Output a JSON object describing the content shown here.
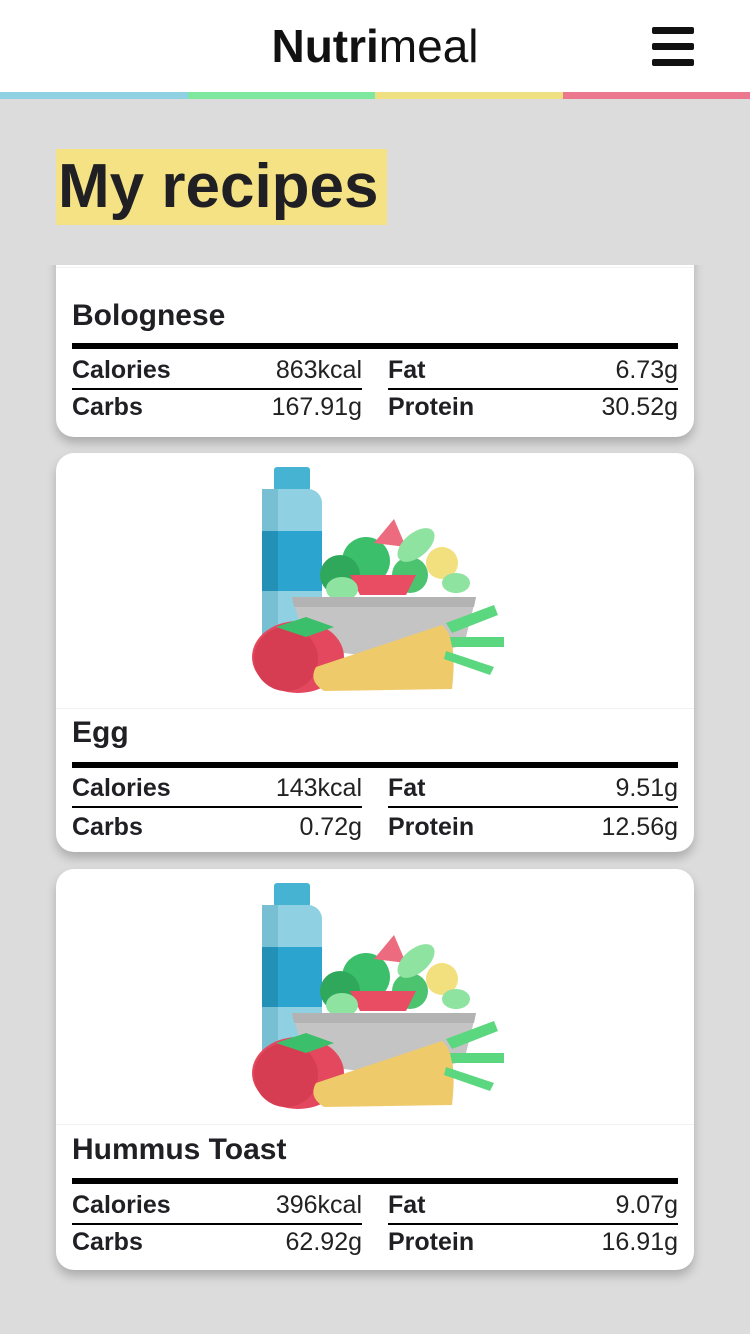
{
  "app": {
    "logo_bold": "Nutri",
    "logo_light": "meal",
    "stripe_colors": [
      "#8fd0e2",
      "#7ee89e",
      "#efe082",
      "#ec7890"
    ]
  },
  "page": {
    "title": "My recipes"
  },
  "recipes": [
    {
      "name": "Bolognese",
      "calories_label": "Calories",
      "calories": "863kcal",
      "fat_label": "Fat",
      "fat": "6.73g",
      "carbs_label": "Carbs",
      "carbs": "167.91g",
      "protein_label": "Protein",
      "protein": "30.52g"
    },
    {
      "name": "Egg",
      "calories_label": "Calories",
      "calories": "143kcal",
      "fat_label": "Fat",
      "fat": "9.51g",
      "carbs_label": "Carbs",
      "carbs": "0.72g",
      "protein_label": "Protein",
      "protein": "12.56g"
    },
    {
      "name": "Hummus Toast",
      "calories_label": "Calories",
      "calories": "396kcal",
      "fat_label": "Fat",
      "fat": "9.07g",
      "carbs_label": "Carbs",
      "carbs": "62.92g",
      "protein_label": "Protein",
      "protein": "16.91g"
    }
  ],
  "icons": {
    "menu": "hamburger-menu-icon",
    "recipe_image": "food-illustration-icon"
  }
}
